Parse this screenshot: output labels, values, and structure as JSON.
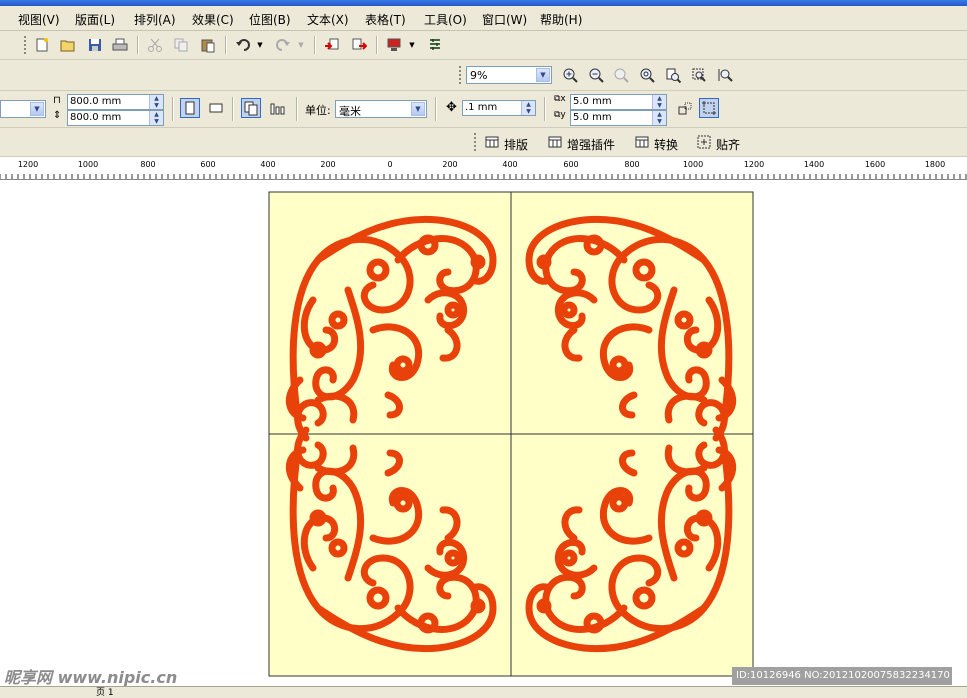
{
  "menu": {
    "items": [
      "视图(V)",
      "版面(L)",
      "排列(A)",
      "效果(C)",
      "位图(B)",
      "文本(X)",
      "表格(T)",
      "工具(O)",
      "窗口(W)",
      "帮助(H)"
    ]
  },
  "toolbar": {
    "icons": [
      "new-document-icon",
      "open-icon",
      "save-icon",
      "print-icon",
      "cut-icon",
      "copy-icon",
      "paste-icon",
      "undo-icon",
      "redo-icon",
      "import-icon",
      "export-icon",
      "application-launcher-icon",
      "options-icon"
    ]
  },
  "zoom": {
    "value": "9%",
    "icons": [
      "zoom-in-icon",
      "zoom-out-icon",
      "zoom-selected-icon",
      "zoom-all-icon",
      "zoom-page-icon",
      "zoom-width-icon",
      "zoom-height-icon"
    ]
  },
  "property_bar": {
    "page_width": "800.0 mm",
    "page_height": "800.0 mm",
    "units_label": "单位:",
    "units_value": "毫米",
    "nudge_value": ".1 mm",
    "duplicate_x": "5.0 mm",
    "duplicate_y": "5.0 mm"
  },
  "plugin_bar": {
    "items": [
      "排版",
      "增强插件",
      "转换",
      "贴齐"
    ]
  },
  "ruler": {
    "labels": [
      "1200",
      "1000",
      "800",
      "600",
      "400",
      "200",
      "0",
      "200",
      "400",
      "600",
      "800",
      "1000",
      "1200",
      "1400",
      "1600",
      "1800"
    ]
  },
  "artwork": {
    "background_color": "#ffffc8",
    "ornament_color": "#e8420a"
  },
  "status": {
    "page_tab": "页 1"
  },
  "watermark": {
    "site": "昵享网 www.nipic.cn",
    "id": "ID:10126946 NO:20121020075832234170"
  }
}
